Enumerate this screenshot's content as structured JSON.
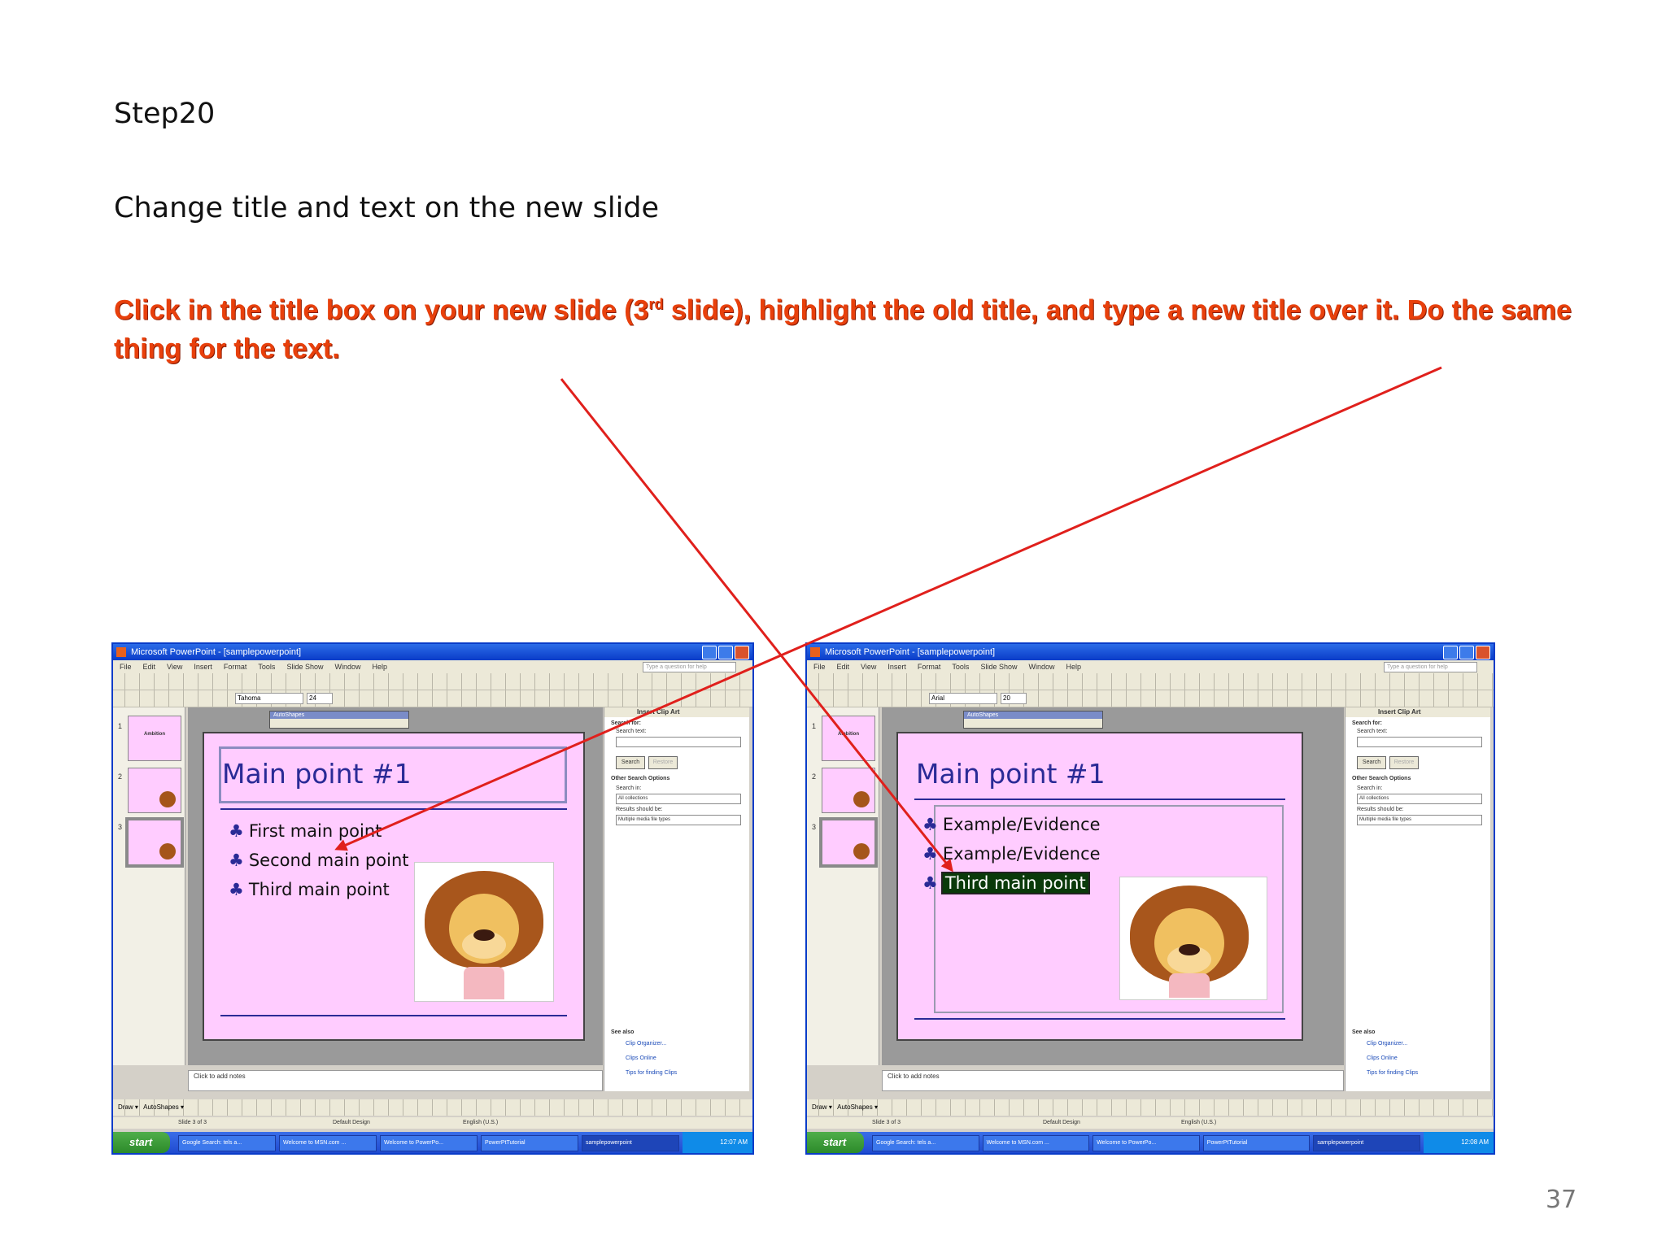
{
  "heading": "Step20",
  "subtitle": "Change title and text on the new slide",
  "instruction": {
    "part1": " Click in the title box on your new slide (3",
    "superscript": "rd",
    "part2": " slide), highlight the old title, and type a new title over it. Do the same thing for the text."
  },
  "page_number": "37",
  "colors": {
    "instruction": "#e8400c",
    "arrow": "#e0201c",
    "slide_bg": "#ffccff",
    "title_text": "#2a2a96"
  },
  "left_shot": {
    "window_title": "Microsoft PowerPoint - [samplepowerpoint]",
    "menu": [
      "File",
      "Edit",
      "View",
      "Insert",
      "Format",
      "Tools",
      "Slide Show",
      "Window",
      "Help"
    ],
    "help_placeholder": "Type a question for help",
    "font_name": "Tahoma",
    "font_size": "24",
    "draw_toolbar_title": "AutoShapes",
    "slide_title": "Main point #1",
    "bullets": [
      "First main point",
      "Second main point",
      "Third main point"
    ],
    "notes_placeholder": "Click to add notes",
    "task_pane": {
      "title": "Insert Clip Art",
      "search_for": "Search for:",
      "search_text": "Search text:",
      "search_btn": "Search",
      "restore_btn": "Restore",
      "other_options": "Other Search Options",
      "search_in": "Search in:",
      "search_in_value": "All collections",
      "results_should_be": "Results should be:",
      "results_value": "Multiple media file types",
      "see_also": "See also",
      "links": [
        "Clip Organizer...",
        "Clips Online",
        "Tips for finding Clips"
      ]
    },
    "draw_label": "Draw",
    "autoshapes_label": "AutoShapes",
    "status": {
      "slide": "Slide 3 of 3",
      "design": "Default Design",
      "lang": "English (U.S.)"
    },
    "start": "start",
    "tasks": [
      "Google Search: tels a...",
      "Welcome to MSN.com ...",
      "Welcome to PowerPo...",
      "PowerPtTutorial",
      "samplepowerpoint"
    ],
    "clock": "12:07 AM",
    "thumb1_title": "Ambition"
  },
  "right_shot": {
    "window_title": "Microsoft PowerPoint - [samplepowerpoint]",
    "menu": [
      "File",
      "Edit",
      "View",
      "Insert",
      "Format",
      "Tools",
      "Slide Show",
      "Window",
      "Help"
    ],
    "help_placeholder": "Type a question for help",
    "font_name": "Arial",
    "font_size": "20",
    "draw_toolbar_title": "AutoShapes",
    "slide_title": "Main point #1",
    "bullets": [
      "Example/Evidence",
      "Example/Evidence",
      "Third main point"
    ],
    "notes_placeholder": "Click to add notes",
    "task_pane": {
      "title": "Insert Clip Art",
      "search_for": "Search for:",
      "search_text": "Search text:",
      "search_btn": "Search",
      "restore_btn": "Restore",
      "other_options": "Other Search Options",
      "search_in": "Search in:",
      "search_in_value": "All collections",
      "results_should_be": "Results should be:",
      "results_value": "Multiple media file types",
      "see_also": "See also",
      "links": [
        "Clip Organizer...",
        "Clips Online",
        "Tips for finding Clips"
      ]
    },
    "draw_label": "Draw",
    "autoshapes_label": "AutoShapes",
    "status": {
      "slide": "Slide 3 of 3",
      "design": "Default Design",
      "lang": "English (U.S.)"
    },
    "start": "start",
    "tasks": [
      "Google Search: tels a...",
      "Welcome to MSN.com ...",
      "Welcome to PowerPo...",
      "PowerPtTutorial",
      "samplepowerpoint"
    ],
    "clock": "12:08 AM",
    "thumb1_title": "Ambition"
  }
}
